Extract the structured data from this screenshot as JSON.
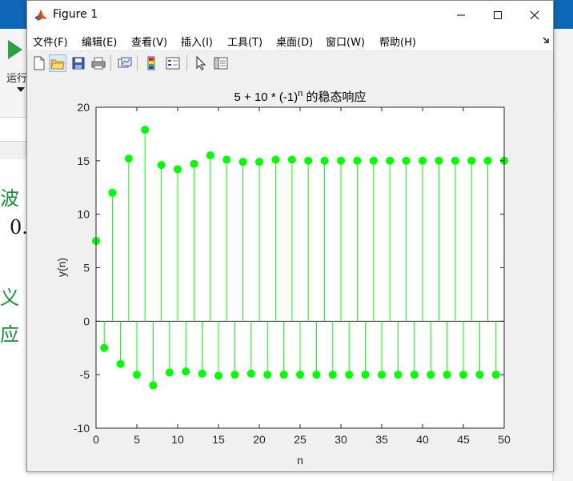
{
  "background": {
    "run_label": "运行",
    "editor_lines": [
      "波",
      "0.",
      "义",
      "应"
    ]
  },
  "window": {
    "title": "Figure 1"
  },
  "menu": [
    {
      "label": "文件(F)"
    },
    {
      "label": "编辑(E)"
    },
    {
      "label": "查看(V)"
    },
    {
      "label": "插入(I)"
    },
    {
      "label": "工具(T)"
    },
    {
      "label": "桌面(D)"
    },
    {
      "label": "窗口(W)"
    },
    {
      "label": "帮助(H)"
    }
  ],
  "toolbar": [
    {
      "icon": "new-figure-icon"
    },
    {
      "icon": "open-file-icon"
    },
    {
      "icon": "save-icon"
    },
    {
      "icon": "print-icon"
    },
    {
      "icon": "link-plot-icon"
    },
    {
      "icon": "colorbar-icon"
    },
    {
      "icon": "legend-icon"
    },
    {
      "icon": "edit-plot-pointer-icon"
    },
    {
      "icon": "property-inspector-icon"
    }
  ],
  "chart_data": {
    "type": "stem",
    "title": "5 + 10 * (-1)^n 的稳态响应",
    "title_parts": {
      "base": "5 + 10 * (-1)",
      "superscript": "n",
      "suffix": " 的稳态响应"
    },
    "xlabel": "n",
    "ylabel": "y(n)",
    "xlim": [
      0,
      50
    ],
    "ylim": [
      -10,
      20
    ],
    "xticks": [
      0,
      5,
      10,
      15,
      20,
      25,
      30,
      35,
      40,
      45,
      50
    ],
    "yticks": [
      -10,
      -5,
      0,
      5,
      10,
      15,
      20
    ],
    "grid": false,
    "color": "#00ff00",
    "x": [
      0,
      1,
      2,
      3,
      4,
      5,
      6,
      7,
      8,
      9,
      10,
      11,
      12,
      13,
      14,
      15,
      16,
      17,
      18,
      19,
      20,
      21,
      22,
      23,
      24,
      25,
      26,
      27,
      28,
      29,
      30,
      31,
      32,
      33,
      34,
      35,
      36,
      37,
      38,
      39,
      40,
      41,
      42,
      43,
      44,
      45,
      46,
      47,
      48,
      49,
      50
    ],
    "values": [
      7.5,
      -2.5,
      12,
      -4,
      15.2,
      -5,
      17.9,
      -6,
      14.6,
      -4.8,
      14.2,
      -4.7,
      14.7,
      -4.9,
      15.5,
      -5.1,
      15.1,
      -5,
      14.9,
      -4.9,
      14.9,
      -5,
      15.1,
      -5,
      15.1,
      -5,
      15,
      -5,
      15,
      -5,
      15,
      -5,
      15,
      -5,
      15,
      -5,
      15,
      -5,
      15,
      -5,
      15,
      -5,
      15,
      -5,
      15,
      -5,
      15,
      -5,
      15,
      -5,
      15
    ]
  }
}
